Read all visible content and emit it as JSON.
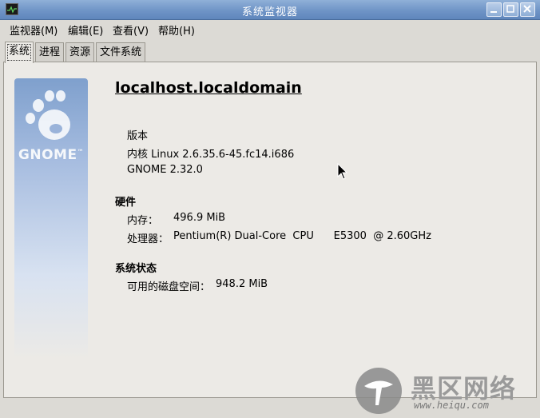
{
  "window": {
    "title": "系统监视器"
  },
  "menu": [
    {
      "label": "监视器(M)"
    },
    {
      "label": "编辑(E)"
    },
    {
      "label": "查看(V)"
    },
    {
      "label": "帮助(H)"
    }
  ],
  "tabs": [
    {
      "label": "系统",
      "active": true
    },
    {
      "label": "进程"
    },
    {
      "label": "资源"
    },
    {
      "label": "文件系统"
    }
  ],
  "logo": {
    "text": "GNOME",
    "tm": "™"
  },
  "system": {
    "hostname": "localhost.localdomain",
    "version_label": "版本",
    "kernel": "内核 Linux 2.6.35.6-45.fc14.i686",
    "desktop": "GNOME 2.32.0"
  },
  "hardware": {
    "heading": "硬件",
    "memory_label": "内存：",
    "memory_value": "496.9 MiB",
    "cpu_label": "处理器：",
    "cpu_value": "Pentium(R) Dual-Core  CPU      E5300  @ 2.60GHz"
  },
  "status": {
    "heading": "系统状态",
    "disk_label": "可用的磁盘空间：",
    "disk_value": "948.2 MiB"
  },
  "watermark": {
    "text": "黑区网络",
    "url": "www.heiqu.com"
  },
  "colors": {
    "titlebar": "#6f94c6",
    "panel": "#eceae6",
    "window_bg": "#dcdad5"
  }
}
